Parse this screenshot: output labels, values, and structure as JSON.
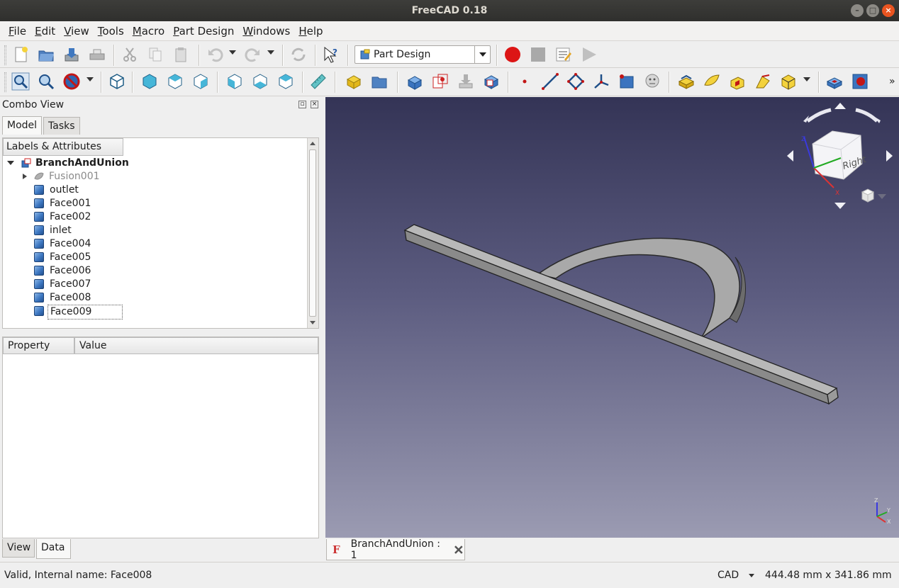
{
  "window": {
    "title": "FreeCAD 0.18"
  },
  "menu": [
    {
      "label": "File",
      "underline": "F",
      "rest": "ile"
    },
    {
      "label": "Edit",
      "underline": "E",
      "rest": "dit"
    },
    {
      "label": "View",
      "underline": "V",
      "rest": "iew"
    },
    {
      "label": "Tools",
      "underline": "T",
      "rest": "ools"
    },
    {
      "label": "Macro",
      "underline": "M",
      "rest": "acro"
    },
    {
      "label": "Part Design",
      "underline": "P",
      "rest": "art Design"
    },
    {
      "label": "Windows",
      "underline": "W",
      "rest": "indows"
    },
    {
      "label": "Help",
      "underline": "H",
      "rest": "elp"
    }
  ],
  "toolbar": {
    "workbench": "Part Design"
  },
  "combo": {
    "title": "Combo View",
    "tabs": {
      "model": "Model",
      "tasks": "Tasks"
    },
    "tree_header": "Labels & Attributes",
    "tree": {
      "root": "BranchAndUnion",
      "items": [
        "Fusion001",
        "outlet",
        "Face001",
        "Face002",
        "inlet",
        "Face004",
        "Face005",
        "Face006",
        "Face007",
        "Face008",
        "Face009"
      ]
    },
    "props_header": {
      "property": "Property",
      "value": "Value"
    },
    "bottom_tabs": {
      "view": "View",
      "data": "Data"
    }
  },
  "navcube": {
    "face_label": "Right"
  },
  "axes": {
    "x": "X",
    "y": "Y",
    "z": "Z"
  },
  "document_tab": "BranchAndUnion : 1",
  "status": {
    "message": "Valid, Internal name: Face008",
    "nav_style": "CAD",
    "dimensions": "444.48 mm x 341.86 mm"
  },
  "colors": {
    "accent_close": "#e95420",
    "viewport_top": "#343456",
    "viewport_bottom": "#9b9bb2",
    "model_grey": "#8a8a8a"
  }
}
